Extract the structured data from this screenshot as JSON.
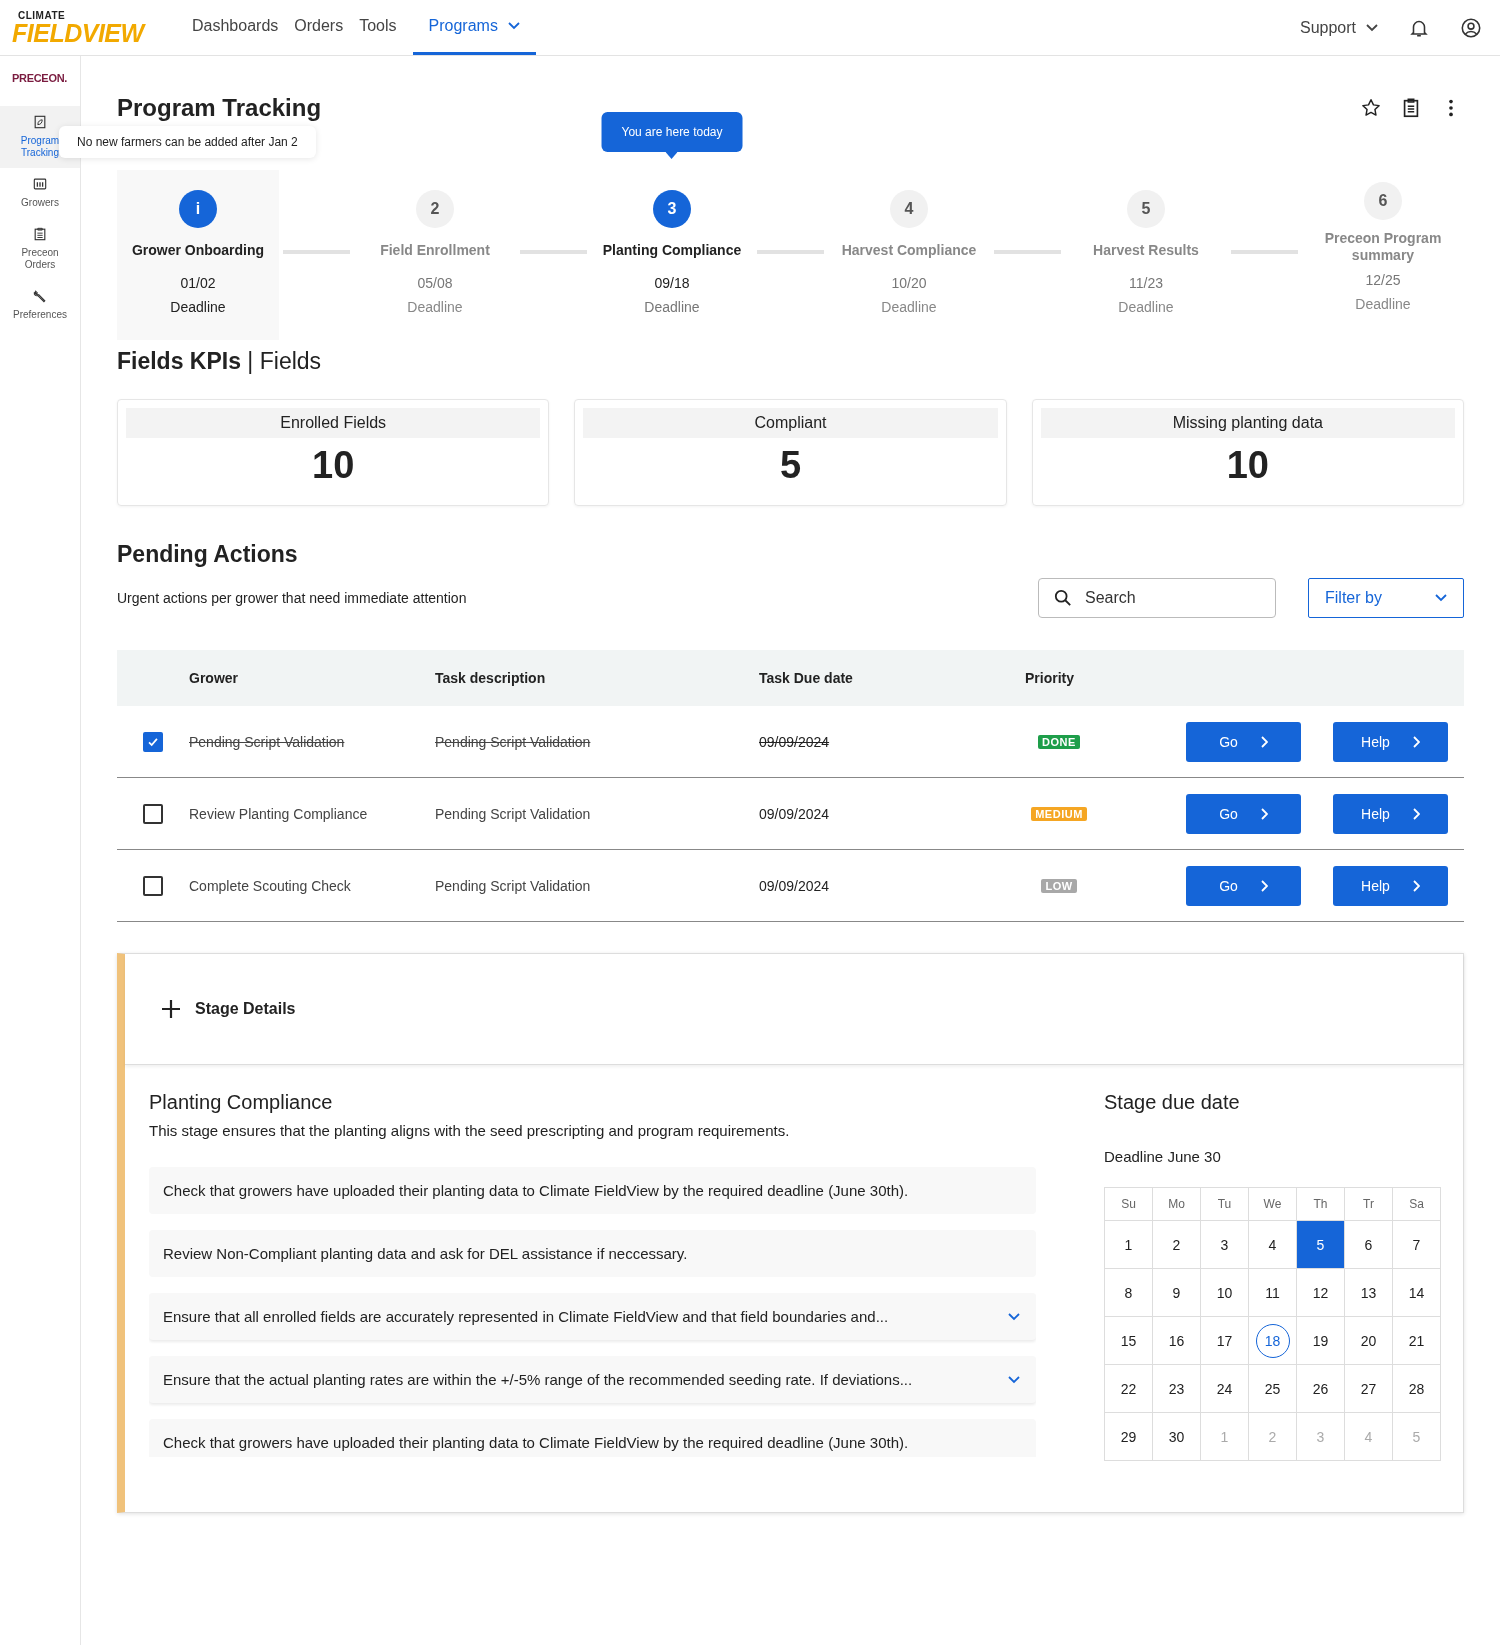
{
  "brand": {
    "top": "CLIMATE",
    "main": "FIELDVIEW"
  },
  "nav": [
    {
      "label": "Dashboards",
      "selected": false,
      "dropdown": false
    },
    {
      "label": "Orders",
      "selected": false,
      "dropdown": false
    },
    {
      "label": "Tools",
      "selected": false,
      "dropdown": false
    },
    {
      "label": "Programs",
      "selected": true,
      "dropdown": true
    }
  ],
  "support": "Support",
  "sidebar": {
    "brand": "PRECEON.",
    "items": [
      {
        "label": "Program Tracking",
        "selected": true
      },
      {
        "label": "Growers",
        "selected": false
      },
      {
        "label": "Preceon Orders",
        "selected": false
      },
      {
        "label": "Preferences",
        "selected": false
      }
    ]
  },
  "title": "Program Tracking",
  "steps": [
    {
      "marker": "i",
      "label": "Grower Onboarding",
      "date": "01/02",
      "note": "Deadline",
      "kind": "info",
      "tooltip": "No new farmers can be added after Jan 2"
    },
    {
      "marker": "2",
      "label": "Field Enrollment",
      "date": "05/08",
      "note": "Deadline",
      "kind": "upcoming"
    },
    {
      "marker": "3",
      "label": "Planting Compliance",
      "date": "09/18",
      "note": "Deadline",
      "kind": "current",
      "tooltip": "You are here today"
    },
    {
      "marker": "4",
      "label": "Harvest Compliance",
      "date": "10/20",
      "note": "Deadline",
      "kind": "upcoming"
    },
    {
      "marker": "5",
      "label": "Harvest Results",
      "date": "11/23",
      "note": "Deadline",
      "kind": "upcoming"
    },
    {
      "marker": "6",
      "label": "Preceon Program summary",
      "date": "12/25",
      "note": "Deadline",
      "kind": "upcoming"
    }
  ],
  "kpi_heading": {
    "bold": "Fields KPIs",
    "separator": "|",
    "rest": "Fields"
  },
  "kpis": [
    {
      "label": "Enrolled Fields",
      "value": "10"
    },
    {
      "label": "Compliant",
      "value": "5"
    },
    {
      "label": "Missing planting data",
      "value": "10"
    }
  ],
  "pending": {
    "title": "Pending Actions",
    "subtitle": "Urgent actions per grower that need immediate attention",
    "search": {
      "placeholder": "Search"
    },
    "filter": "Filter by"
  },
  "table": {
    "columns": [
      "Grower",
      "Task description",
      "Task Due date",
      "Priority"
    ],
    "rows": [
      {
        "checked": true,
        "grower": "Pending Script Validation",
        "task": "Pending Script Validation",
        "due": "09/09/2024",
        "priority": {
          "label": "DONE",
          "kind": "done"
        },
        "go": "Go",
        "help": "Help"
      },
      {
        "checked": false,
        "grower": "Review Planting Compliance",
        "task": "Pending Script Validation",
        "due": "09/09/2024",
        "priority": {
          "label": "MEDIUM",
          "kind": "medium"
        },
        "go": "Go",
        "help": "Help"
      },
      {
        "checked": false,
        "grower": "Complete Scouting Check",
        "task": "Pending Script Validation",
        "due": "09/09/2024",
        "priority": {
          "label": "LOW",
          "kind": "low"
        },
        "go": "Go",
        "help": "Help"
      }
    ]
  },
  "stage": {
    "header": "Stage Details",
    "expanded": true,
    "title": "Planting Compliance",
    "description": "This stage ensures that the planting aligns with the seed prescripting and program requirements.",
    "items": [
      {
        "text": "Check that growers have uploaded their planting data to Climate FieldView by the required deadline (June 30th).",
        "expandable": false
      },
      {
        "text": "Review Non-Compliant planting data and ask for DEL assistance if neccessary.",
        "expandable": false
      },
      {
        "text": "Ensure that all enrolled fields are accurately represented in Climate FieldView and that field boundaries and...",
        "expandable": true
      },
      {
        "text": "Ensure that the actual planting rates are within the +/-5% range of the recommended seeding rate. If deviations...",
        "expandable": true
      },
      {
        "text": "Check that growers have uploaded their planting data to Climate FieldView by the required deadline (June 30th).",
        "expandable": false
      }
    ],
    "due_title": "Stage due date",
    "deadline": "Deadline June 30",
    "weekdays": [
      "Su",
      "Mo",
      "Tu",
      "We",
      "Th",
      "Tr",
      "Sa"
    ],
    "days": [
      {
        "d": "1",
        "selected": false,
        "kind": "day"
      },
      {
        "d": "2",
        "selected": false,
        "kind": "day"
      },
      {
        "d": "3",
        "selected": false,
        "kind": "day"
      },
      {
        "d": "4",
        "selected": false,
        "kind": "day"
      },
      {
        "d": "5",
        "selected": true,
        "kind": "day"
      },
      {
        "d": "6",
        "selected": false,
        "kind": "day"
      },
      {
        "d": "7",
        "selected": false,
        "kind": "day"
      },
      {
        "d": "8",
        "selected": false,
        "kind": "day"
      },
      {
        "d": "9",
        "selected": false,
        "kind": "day"
      },
      {
        "d": "10",
        "selected": false,
        "kind": "day"
      },
      {
        "d": "11",
        "selected": false,
        "kind": "day"
      },
      {
        "d": "12",
        "selected": false,
        "kind": "day"
      },
      {
        "d": "13",
        "selected": false,
        "kind": "day"
      },
      {
        "d": "14",
        "selected": false,
        "kind": "day"
      },
      {
        "d": "15",
        "selected": false,
        "kind": "day"
      },
      {
        "d": "16",
        "selected": false,
        "kind": "day"
      },
      {
        "d": "17",
        "selected": false,
        "kind": "day"
      },
      {
        "d": "18",
        "selected": false,
        "kind": "today"
      },
      {
        "d": "19",
        "selected": false,
        "kind": "day"
      },
      {
        "d": "20",
        "selected": false,
        "kind": "day"
      },
      {
        "d": "21",
        "selected": false,
        "kind": "day"
      },
      {
        "d": "22",
        "selected": false,
        "kind": "day"
      },
      {
        "d": "23",
        "selected": false,
        "kind": "day"
      },
      {
        "d": "24",
        "selected": false,
        "kind": "day"
      },
      {
        "d": "25",
        "selected": false,
        "kind": "day"
      },
      {
        "d": "26",
        "selected": false,
        "kind": "day"
      },
      {
        "d": "27",
        "selected": false,
        "kind": "day"
      },
      {
        "d": "28",
        "selected": false,
        "kind": "day"
      },
      {
        "d": "29",
        "selected": false,
        "kind": "day"
      },
      {
        "d": "30",
        "selected": false,
        "kind": "day"
      },
      {
        "d": "1",
        "selected": false,
        "kind": "outside"
      },
      {
        "d": "2",
        "selected": false,
        "kind": "outside"
      },
      {
        "d": "3",
        "selected": false,
        "kind": "outside"
      },
      {
        "d": "4",
        "selected": false,
        "kind": "outside"
      },
      {
        "d": "5",
        "selected": false,
        "kind": "outside"
      }
    ]
  }
}
